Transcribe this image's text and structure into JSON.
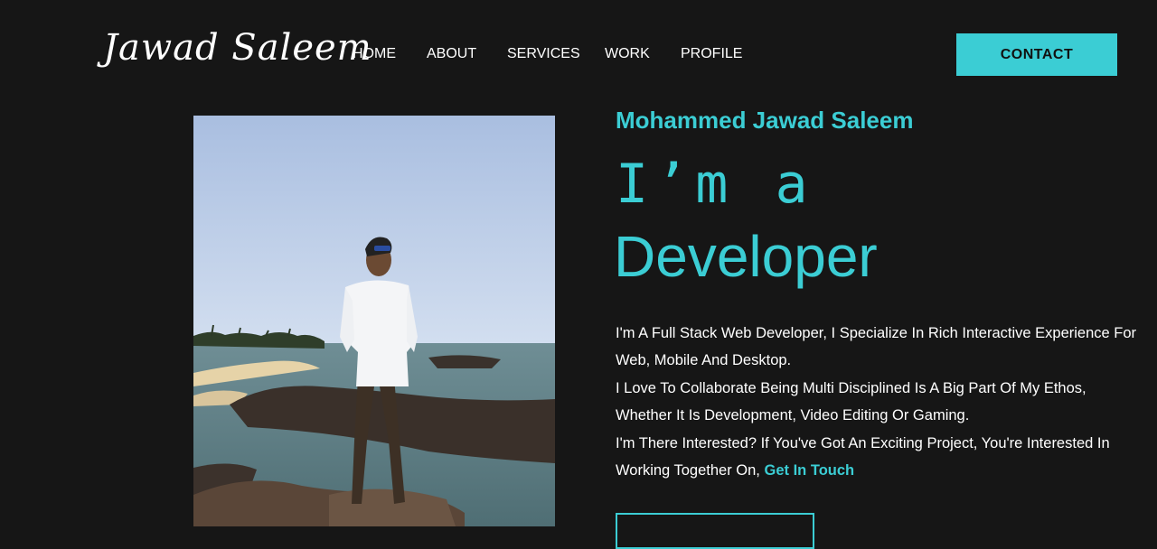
{
  "header": {
    "logo_text": "Jawad Saleem",
    "nav": [
      "HOME",
      "ABOUT",
      "SERVICES",
      "WORK",
      "PROFILE"
    ],
    "contact_label": "CONTACT"
  },
  "hero": {
    "name": "Mohammed Jawad Saleem",
    "intro": "I’m a",
    "role": "Developer",
    "bio_lines": [
      "I'm A Full Stack Web Developer, I Specialize In Rich Interactive Experience For Web, Mobile And Desktop.",
      "I Love To Collaborate Being Multi Disciplined Is A Big Part Of My Ethos, Whether It Is Development, Video Editing Or Gaming.",
      "I'm There Interested? If You've Got An Exciting Project, You're Interested In Working Together On,"
    ],
    "cta_link": "Get In Touch"
  },
  "colors": {
    "accent": "#3bcdd4",
    "background": "#161616",
    "text": "#ffffff"
  }
}
